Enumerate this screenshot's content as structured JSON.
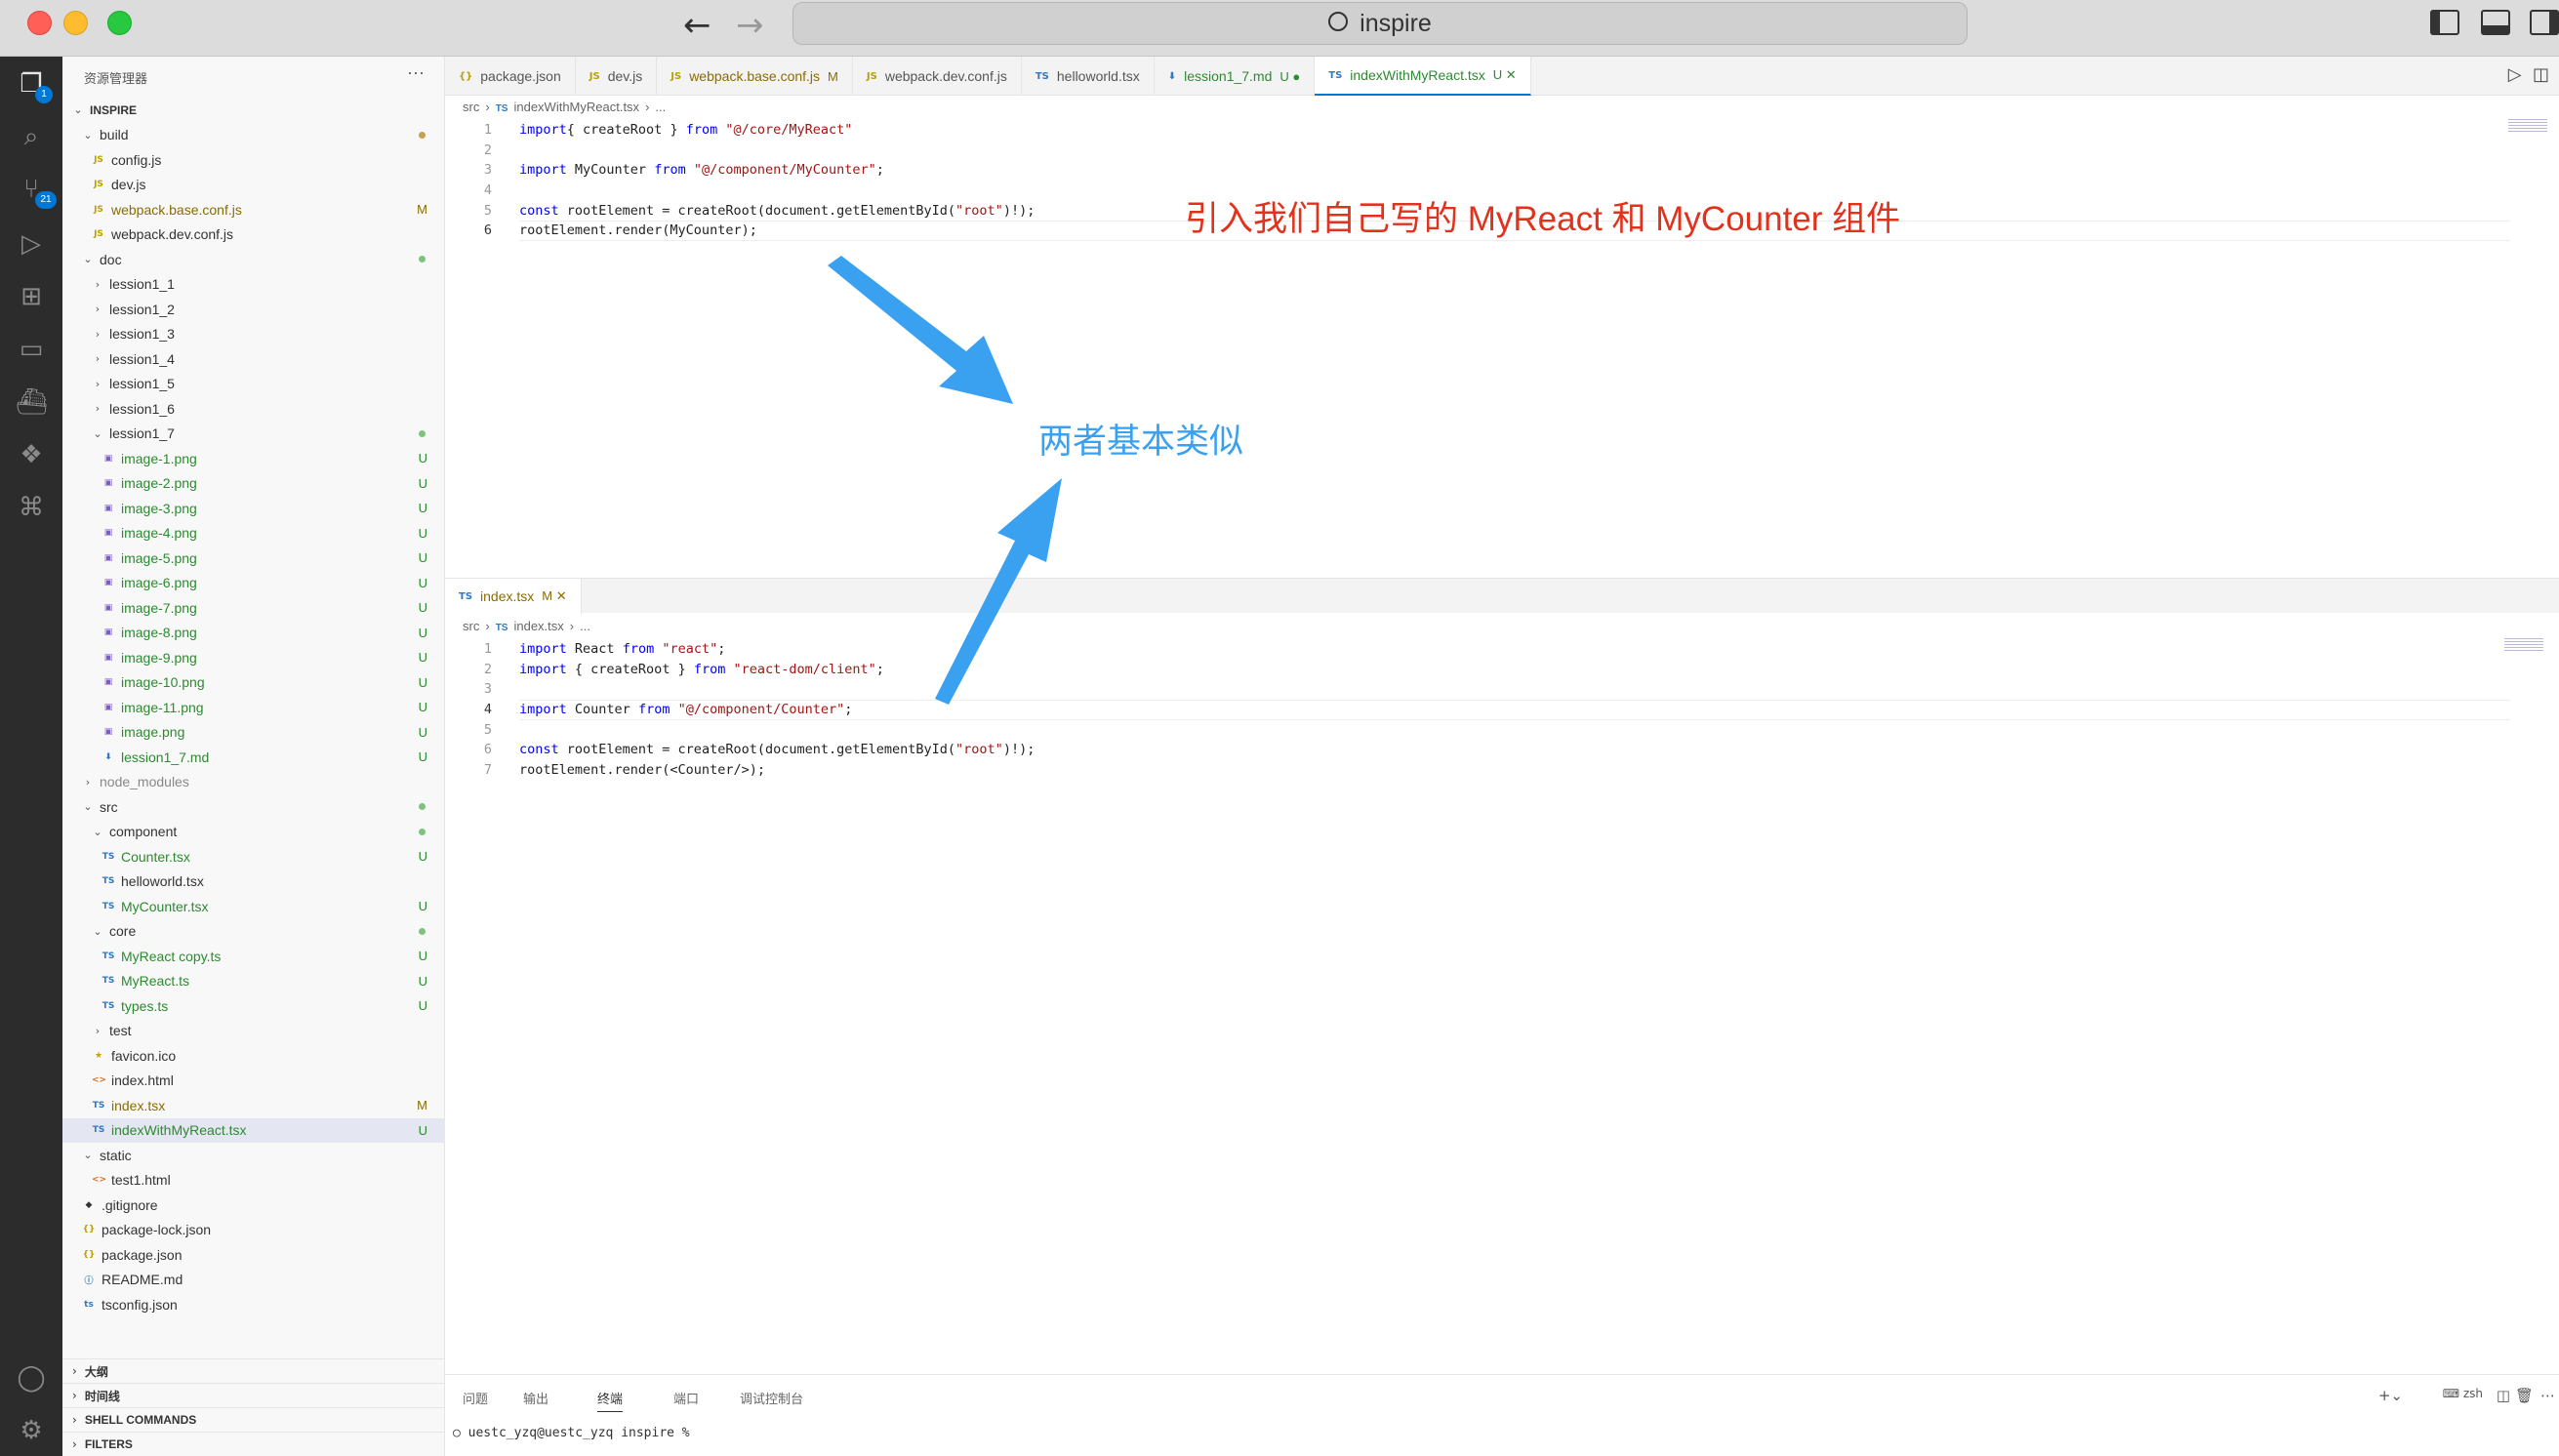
{
  "window": {
    "title": "inspire"
  },
  "activity": {
    "explorer_badge": "1",
    "scm_badge": "21"
  },
  "sidebar": {
    "title": "资源管理器",
    "more": "···",
    "tree": [
      {
        "label": "INSPIRE",
        "depth": 0,
        "type": "root",
        "chev": "v"
      },
      {
        "label": "build",
        "depth": 1,
        "type": "folder",
        "chev": "v",
        "status": "dot-mod"
      },
      {
        "label": "config.js",
        "depth": 2,
        "type": "js"
      },
      {
        "label": "dev.js",
        "depth": 2,
        "type": "js"
      },
      {
        "label": "webpack.base.conf.js",
        "depth": 2,
        "type": "js",
        "status": "M"
      },
      {
        "label": "webpack.dev.conf.js",
        "depth": 2,
        "type": "js"
      },
      {
        "label": "doc",
        "depth": 1,
        "type": "folder",
        "chev": "v",
        "status": "dot-unt"
      },
      {
        "label": "lession1_1",
        "depth": 2,
        "type": "folder",
        "chev": ">"
      },
      {
        "label": "lession1_2",
        "depth": 2,
        "type": "folder",
        "chev": ">"
      },
      {
        "label": "lession1_3",
        "depth": 2,
        "type": "folder",
        "chev": ">"
      },
      {
        "label": "lession1_4",
        "depth": 2,
        "type": "folder",
        "chev": ">"
      },
      {
        "label": "lession1_5",
        "depth": 2,
        "type": "folder",
        "chev": ">"
      },
      {
        "label": "lession1_6",
        "depth": 2,
        "type": "folder",
        "chev": ">"
      },
      {
        "label": "lession1_7",
        "depth": 2,
        "type": "folder",
        "chev": "v",
        "status": "dot-unt"
      },
      {
        "label": "image-1.png",
        "depth": 3,
        "type": "img",
        "status": "U"
      },
      {
        "label": "image-2.png",
        "depth": 3,
        "type": "img",
        "status": "U"
      },
      {
        "label": "image-3.png",
        "depth": 3,
        "type": "img",
        "status": "U"
      },
      {
        "label": "image-4.png",
        "depth": 3,
        "type": "img",
        "status": "U"
      },
      {
        "label": "image-5.png",
        "depth": 3,
        "type": "img",
        "status": "U"
      },
      {
        "label": "image-6.png",
        "depth": 3,
        "type": "img",
        "status": "U"
      },
      {
        "label": "image-7.png",
        "depth": 3,
        "type": "img",
        "status": "U"
      },
      {
        "label": "image-8.png",
        "depth": 3,
        "type": "img",
        "status": "U"
      },
      {
        "label": "image-9.png",
        "depth": 3,
        "type": "img",
        "status": "U"
      },
      {
        "label": "image-10.png",
        "depth": 3,
        "type": "img",
        "status": "U"
      },
      {
        "label": "image-11.png",
        "depth": 3,
        "type": "img",
        "status": "U"
      },
      {
        "label": "image.png",
        "depth": 3,
        "type": "img",
        "status": "U"
      },
      {
        "label": "lession1_7.md",
        "depth": 3,
        "type": "md",
        "status": "U"
      },
      {
        "label": "node_modules",
        "depth": 1,
        "type": "folder",
        "chev": ">",
        "dim": true
      },
      {
        "label": "src",
        "depth": 1,
        "type": "folder",
        "chev": "v",
        "status": "dot-unt"
      },
      {
        "label": "component",
        "depth": 2,
        "type": "folder",
        "chev": "v",
        "status": "dot-unt"
      },
      {
        "label": "Counter.tsx",
        "depth": 3,
        "type": "ts",
        "status": "U"
      },
      {
        "label": "helloworld.tsx",
        "depth": 3,
        "type": "ts"
      },
      {
        "label": "MyCounter.tsx",
        "depth": 3,
        "type": "ts",
        "status": "U"
      },
      {
        "label": "core",
        "depth": 2,
        "type": "folder",
        "chev": "v",
        "status": "dot-unt"
      },
      {
        "label": "MyReact copy.ts",
        "depth": 3,
        "type": "ts",
        "status": "U"
      },
      {
        "label": "MyReact.ts",
        "depth": 3,
        "type": "ts",
        "status": "U"
      },
      {
        "label": "types.ts",
        "depth": 3,
        "type": "ts",
        "status": "U"
      },
      {
        "label": "test",
        "depth": 2,
        "type": "folder",
        "chev": ">"
      },
      {
        "label": "favicon.ico",
        "depth": 2,
        "type": "ico"
      },
      {
        "label": "index.html",
        "depth": 2,
        "type": "html"
      },
      {
        "label": "index.tsx",
        "depth": 2,
        "type": "ts",
        "status": "M"
      },
      {
        "label": "indexWithMyReact.tsx",
        "depth": 2,
        "type": "ts",
        "status": "U",
        "selected": true
      },
      {
        "label": "static",
        "depth": 1,
        "type": "folder",
        "chev": "v"
      },
      {
        "label": "test1.html",
        "depth": 2,
        "type": "html"
      },
      {
        "label": ".gitignore",
        "depth": 1,
        "type": "git"
      },
      {
        "label": "package-lock.json",
        "depth": 1,
        "type": "json"
      },
      {
        "label": "package.json",
        "depth": 1,
        "type": "json"
      },
      {
        "label": "README.md",
        "depth": 1,
        "type": "info"
      },
      {
        "label": "tsconfig.json",
        "depth": 1,
        "type": "tsconfig"
      }
    ],
    "sections": [
      "大纲",
      "时间线",
      "SHELL COMMANDS",
      "FILTERS"
    ]
  },
  "tabs": [
    {
      "icon": "{}",
      "label": "package.json"
    },
    {
      "icon": "JS",
      "label": "dev.js"
    },
    {
      "icon": "JS",
      "label": "webpack.base.conf.js",
      "mark": "M"
    },
    {
      "icon": "JS",
      "label": "webpack.dev.conf.js"
    },
    {
      "icon": "TS",
      "label": "helloworld.tsx"
    },
    {
      "icon": "⬇",
      "label": "lession1_7.md",
      "mark": "U ●"
    },
    {
      "icon": "TS",
      "label": "indexWithMyReact.tsx",
      "mark": "U ✕",
      "active": true
    }
  ],
  "editor1": {
    "breadcrumb": [
      "src",
      "›",
      "TS",
      "indexWithMyReact.tsx",
      "›",
      "..."
    ],
    "lines": [
      {
        "n": "1",
        "code": [
          [
            "kw",
            "import"
          ],
          [
            "",
            "{ createRoot } "
          ],
          [
            "kw",
            "from"
          ],
          [
            "str",
            " \"@/core/MyReact\""
          ]
        ]
      },
      {
        "n": "2",
        "code": []
      },
      {
        "n": "3",
        "code": [
          [
            "kw",
            "import"
          ],
          [
            "",
            " MyCounter "
          ],
          [
            "kw",
            "from"
          ],
          [
            "str",
            " \"@/component/MyCounter\""
          ],
          [
            "",
            ";"
          ]
        ]
      },
      {
        "n": "4",
        "code": []
      },
      {
        "n": "5",
        "code": [
          [
            "kw",
            "const"
          ],
          [
            "",
            " rootElement = createRoot(document.getElementById("
          ],
          [
            "str",
            "\"root\""
          ],
          [
            "",
            ")!);"
          ]
        ]
      },
      {
        "n": "6",
        "code": [
          [
            "",
            "rootElement.render(MyCounter);"
          ]
        ],
        "current": true
      }
    ]
  },
  "editor2": {
    "tab": {
      "icon": "TS",
      "label": "index.tsx",
      "mark": "M ✕"
    },
    "breadcrumb": [
      "src",
      "›",
      "TS",
      "index.tsx",
      "›",
      "..."
    ],
    "lines": [
      {
        "n": "1",
        "code": [
          [
            "kw",
            "import"
          ],
          [
            "",
            " React "
          ],
          [
            "kw",
            "from"
          ],
          [
            "str",
            " \"react\""
          ],
          [
            "",
            ";"
          ]
        ]
      },
      {
        "n": "2",
        "code": [
          [
            "kw",
            "import"
          ],
          [
            "",
            " { createRoot } "
          ],
          [
            "kw",
            "from"
          ],
          [
            "str",
            " \"react-dom/client\""
          ],
          [
            "",
            ";"
          ]
        ]
      },
      {
        "n": "3",
        "code": []
      },
      {
        "n": "4",
        "code": [
          [
            "kw",
            "import"
          ],
          [
            "",
            " Counter "
          ],
          [
            "kw",
            "from"
          ],
          [
            "str",
            " \"@/component/Counter\""
          ],
          [
            "",
            ";"
          ]
        ],
        "current": true
      },
      {
        "n": "5",
        "code": []
      },
      {
        "n": "6",
        "code": [
          [
            "kw",
            "const"
          ],
          [
            "",
            " rootElement = createRoot(document.getElementById("
          ],
          [
            "str",
            "\"root\""
          ],
          [
            "",
            ")!);"
          ]
        ]
      },
      {
        "n": "7",
        "code": [
          [
            "",
            "rootElement.render(<Counter/>);"
          ]
        ]
      }
    ]
  },
  "annotations": {
    "red_text": "引入我们自己写的 MyReact 和 MyCounter 组件",
    "blue_text": "两者基本类似",
    "red_color": "#e0321d",
    "blue_color": "#3aa0f0"
  },
  "panel": {
    "tabs": [
      "问题",
      "输出",
      "终端",
      "端口",
      "调试控制台"
    ],
    "active_tab": "终端",
    "shell": "zsh",
    "prompt": "uestc_yzq@uestc_yzq inspire %"
  },
  "colors": {
    "accent": "#0078d4",
    "modified": "#8a6c00",
    "untracked": "#2c8a30",
    "activity_bg": "#2c2c2c",
    "sidebar_bg": "#f8f8f8"
  }
}
